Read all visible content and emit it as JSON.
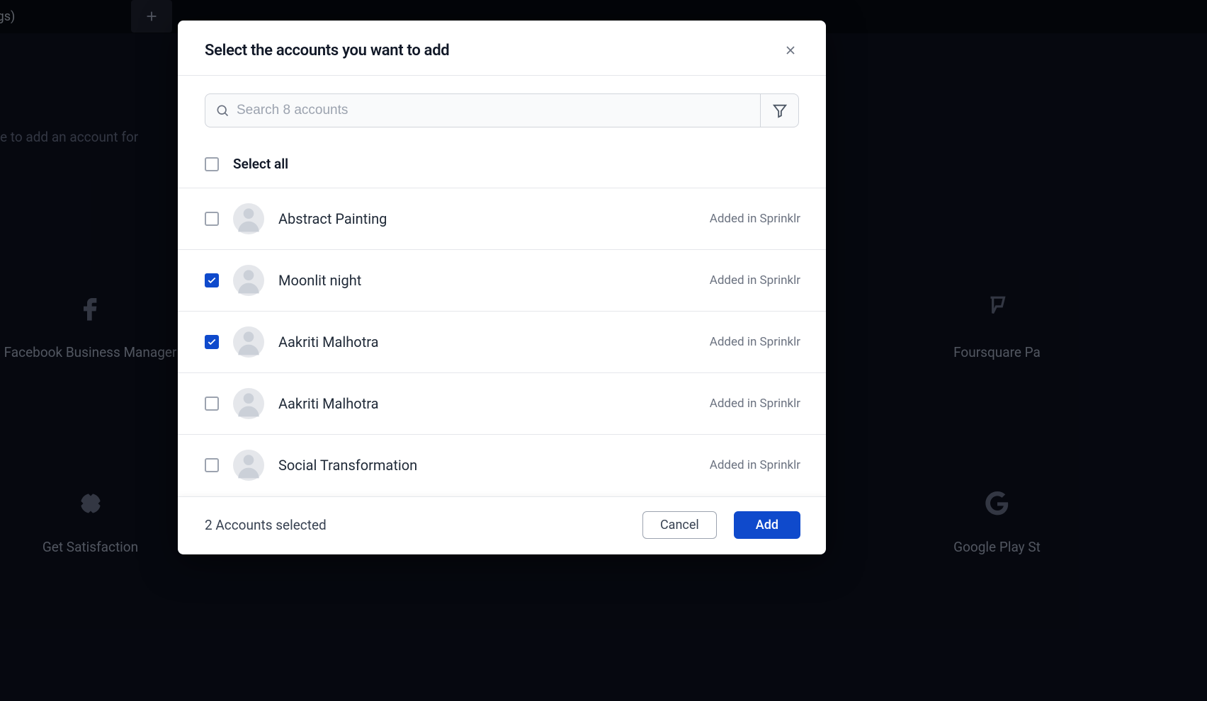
{
  "background": {
    "tab_partial": "ettings)",
    "subtitle_partial": "e to add an account for",
    "tiles": [
      {
        "label": "Facebook Business Manager",
        "icon": "facebook"
      },
      {
        "label": "Get Satisfaction",
        "icon": "satisfaction"
      },
      {
        "label": "Foursquare Pa",
        "icon": "foursquare"
      },
      {
        "label": "Google Play St",
        "icon": "google"
      }
    ]
  },
  "modal": {
    "title": "Select the accounts you want to add",
    "search_placeholder": "Search 8 accounts",
    "select_all_label": "Select all",
    "accounts": [
      {
        "name": "Abstract Painting",
        "status": "Added in Sprinklr",
        "checked": false
      },
      {
        "name": "Moonlit night",
        "status": "Added in Sprinklr",
        "checked": true
      },
      {
        "name": "Aakriti Malhotra",
        "status": "Added in Sprinklr",
        "checked": true
      },
      {
        "name": "Aakriti Malhotra",
        "status": "Added in Sprinklr",
        "checked": false
      },
      {
        "name": "Social Transformation",
        "status": "Added in Sprinklr",
        "checked": false
      }
    ],
    "footer": {
      "selected_text": "2 Accounts selected",
      "cancel_label": "Cancel",
      "add_label": "Add"
    }
  }
}
